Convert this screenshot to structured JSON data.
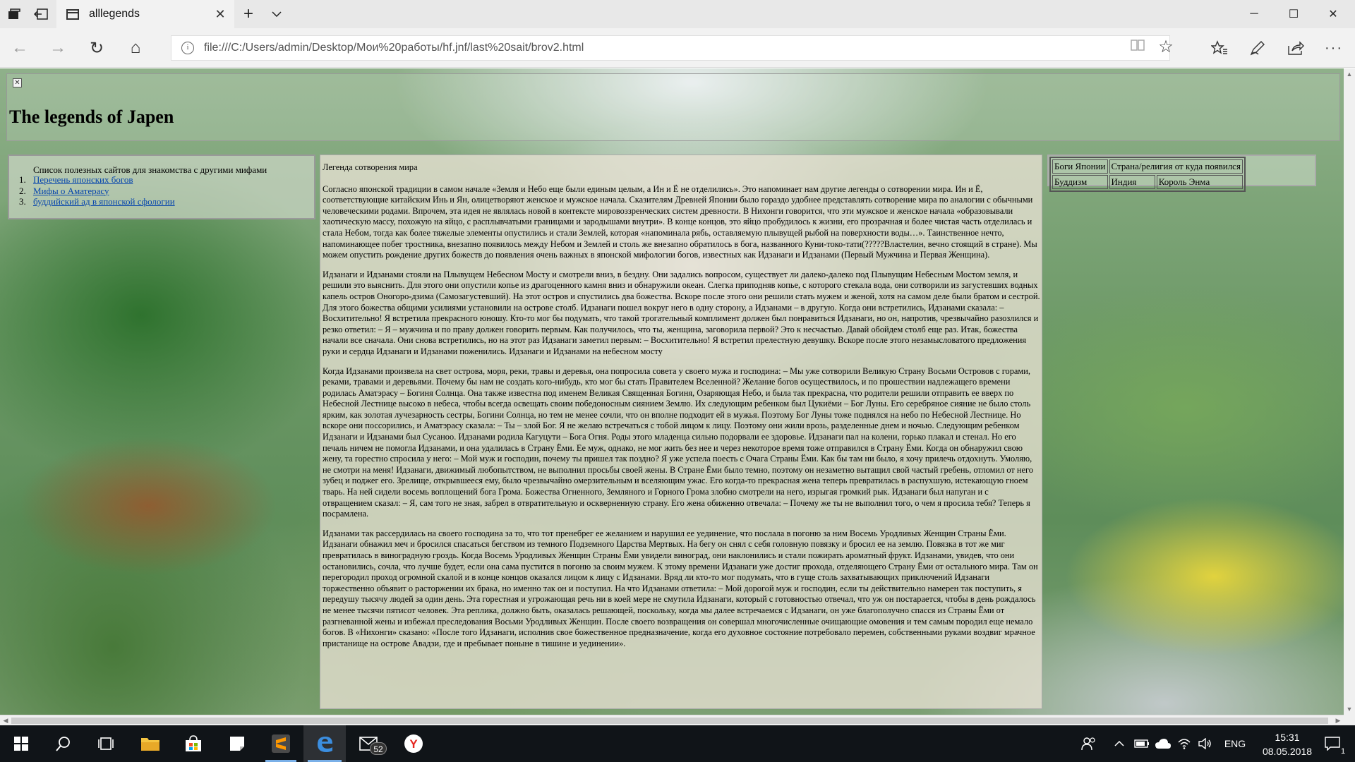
{
  "browser": {
    "tab_title": "alllegends",
    "url": "file:///C:/Users/admin/Desktop/Мои%20работы/hf.jnf/last%20sait/brov2.html",
    "tab_icons": {
      "tab_manager": "tab-preview-icon",
      "set_aside": "set-tabs-aside-icon",
      "new_tab": "plus-icon",
      "tab_list": "chevron-down-icon"
    },
    "window_controls": {
      "minimize": "─",
      "maximize": "☐",
      "close": "✕"
    },
    "nav": {
      "back": "←",
      "forward": "→",
      "refresh": "↻",
      "home": "⌂"
    }
  },
  "page": {
    "title": "The legends of Japen",
    "links_heading": "Список полезных сайтов для знакомства с другими мифами",
    "links": [
      {
        "num": "1.",
        "label": "Перечень японских богов"
      },
      {
        "num": "2.",
        "label": "Мифы о Аматерасу"
      },
      {
        "num": "3.",
        "label": "буддийский ад в японской сфологии"
      }
    ],
    "legend_heading": "Легенда сотворения мира",
    "paragraphs": [
      "Согласно японской традиции в самом начале «Земля и Небо еще были единым целым, а Ин и Ё не отделились». Это напоминает нам другие легенды о сотворении мира. Ин и Ё, соответствующие китайским Инь и Ян, олицетворяют женское и мужское начала. Сказителям Древней Японии было гораздо удобнее представлять сотворение мира по аналогии с обычными человеческими родами. Впрочем, эта идея не являлась новой в контексте мировоззренческих систем древности. В Нихонги говорится, что эти мужское и женское начала «образовывали хаотическую массу, похожую на яйцо, с расплывчатыми границами и зародышами внутри». В конце концов, это яйцо пробудилось к жизни, его прозрачная и более чистая часть отделилась и стала Небом, тогда как более тяжелые элементы опустились и стали Землей, которая «напоминала рябь, оставляемую плывущей рыбой на поверхности воды…». Таинственное нечто, напоминающее побег тростника, внезапно появилось между Небом и Землей и столь же внезапно обратилось в бога, названного Куни-токо-тати(?????Властелин, вечно стоящий в стране). Мы можем опустить рождение других божеств до появления очень важных в японской мифологии богов, известных как Идзанаги и Идзанами (Первый Мужчина и Первая Женщина).",
      "Идзанаги и Идзанами стояли на Плывущем Небесном Мосту и смотрели вниз, в бездну. Они задались вопросом, существует ли далеко-далеко под Плывущим Небесным Мостом земля, и решили это выяснить. Для этого они опустили копье из драгоценного камня вниз и обнаружили океан. Слегка приподняв копье, с которого стекала вода, они сотворили из загустевших водных капель остров Оногоро-дзима (Самозагустевший). На этот остров и спустились два божества. Вскоре после этого они решили стать мужем и женой, хотя на самом деле были братом и сестрой. Для этого божества общими усилиями установили на острове столб. Идзанаги пошел вокруг него в одну сторону, а Идзанами – в другую. Когда они встретились, Идзанами сказала: – Восхитительно! Я встретила прекрасного юношу. Кто-то мог бы подумать, что такой трогательный комплимент должен был понравиться Идзанаги, но он, напротив, чрезвычайно разозлился и резко ответил: – Я – мужчина и по праву должен говорить первым. Как получилось, что ты, женщина, заговорила первой? Это к несчастью. Давай обойдем столб еще раз. Итак, божества начали все сначала. Они снова встретились, но на этот раз Идзанаги заметил первым: – Восхитительно! Я встретил прелестную девушку. Вскоре после этого незамысловатого предложения руки и сердца Идзанаги и Идзанами поженились. Идзанаги и Идзанами на небесном мосту",
      "Когда Идзанами произвела на свет острова, моря, реки, травы и деревья, она попросила совета у своего мужа и господина: – Мы уже сотворили Великую Страну Восьми Островов с горами, реками, травами и деревьями. Почему бы нам не создать кого-нибудь, кто мог бы стать Правителем Вселенной? Желание богов осуществилось, и по прошествии надлежащего времени родилась Аматэрасу – Богиня Солнца. Она также известна под именем Великая Священная Богиня, Озаряющая Небо, и была так прекрасна, что родители решили отправить ее вверх по Небесной Лестнице высоко в небеса, чтобы всегда освещать своим победоносным сиянием Землю. Их следующим ребенком был Цукиёми – Бог Луны. Его серебряное сияние не было столь ярким, как золотая лучезарность сестры, Богини Солнца, но тем не менее сочли, что он вполне подходит ей в мужья. Поэтому Бог Луны тоже поднялся на небо по Небесной Лестнице. Но вскоре они поссорились, и Аматэрасу сказала: – Ты – злой Бог. Я не желаю встречаться с тобой лицом к лицу. Поэтому они жили врозь, разделенные днем и ночью. Следующим ребенком Идзанаги и Идзанами был Сусаноо. Идзанами родила Кагуцути – Бога Огня. Роды этого младенца сильно подорвали ее здоровье. Идзанаги пал на колени, горько плакал и стенал. Но его печаль ничем не помогла Идзанами, и она удалилась в Страну Ёми. Ее муж, однако, не мог жить без нее и через некоторое время тоже отправился в Страну Ёми. Когда он обнаружил свою жену, та горестно спросила у него: – Мой муж и господин, почему ты пришел так поздно? Я уже успела поесть с Очага Страны Ёми. Как бы там ни было, я хочу прилечь отдохнуть. Умоляю, не смотри на меня! Идзанаги, движимый любопытством, не выполнил просьбы своей жены. В Стране Ёми было темно, поэтому он незаметно вытащил свой частый гребень, отломил от него зубец и поджег его. Зрелище, открывшееся ему, было чрезвычайно омерзительным и вселяющим ужас. Его когда-то прекрасная жена теперь превратилась в распухшую, истекающую гноем тварь. На ней сидели восемь воплощений бога Грома. Божества Огненного, Земляного и Горного Грома злобно смотрели на него, изрыгая громкий рык. Идзанаги был напуган и с отвращением сказал: – Я, сам того не зная, забрел в отвратительную и оскверненную страну. Его жена обиженно отвечала: – Почему же ты не выполнил того, о чем я просила тебя? Теперь я посрамлена.",
      "Идзанами так рассердилась на своего господина за то, что тот пренебрег ее желанием и нарушил ее уединение, что послала в погоню за ним Восемь Уродливых Женщин Страны Ёми. Идзанаги обнажил меч и бросился спасаться бегством из темного Подземного Царства Мертвых. На бегу он снял с себя головную повязку и бросил ее на землю. Повязка в тот же миг превратилась в виноградную гроздь. Когда Восемь Уродливых Женщин Страны Ёми увидели виноград, они наклонились и стали пожирать ароматный фрукт. Идзанами, увидев, что они остановились, сочла, что лучше будет, если она сама пустится в погоню за своим мужем. К этому времени Идзанаги уже достиг прохода, отделяющего Страну Ёми от остального мира. Там он перегородил проход огромной скалой и в конце концов оказался лицом к лицу с Идзанами. Вряд ли кто-то мог подумать, что в гуще столь захватывающих приключений Идзанаги торжественно объявит о расторжении их брака, но именно так он и поступил. На что Идзанами ответила: – Мой дорогой муж и господин, если ты действительно намерен так поступить, я передушу тысячу людей за один день. Эта горестная и угрожающая речь ни в коей мере не смутила Идзанаги, который с готовностью отвечал, что уж он постарается, чтобы в день рождалось не менее тысячи пятисот человек. Эта реплика, должно быть, оказалась решающей, поскольку, когда мы далее встречаемся с Идзанаги, он уже благополучно спасся из Страны Ёми от разгневанной жены и избежал преследования Восьми Уродливых Женщин. После своего возвращения он совершал многочисленные очищающие омовения и тем самым породил еще немало богов. В «Нихонги» сказано: «После того Идзанаги, исполнив свое божественное предназначение, когда его духовное состояние потребовало перемен, собственными руками воздвиг мрачное пристанище на острове Авадзи, где и пребывает поныне в тишине и уединении»."
    ],
    "table": {
      "header": [
        "Боги Японии",
        "Страна/религия от куда появился"
      ],
      "rows": [
        [
          "Буддизм",
          "Индия",
          "Король Энма"
        ]
      ]
    }
  },
  "taskbar": {
    "mail_count": "52",
    "time": "15:31",
    "date": "08.05.2018",
    "language": "ENG",
    "notifications": "1",
    "accent_color": "#7ab0e8"
  }
}
